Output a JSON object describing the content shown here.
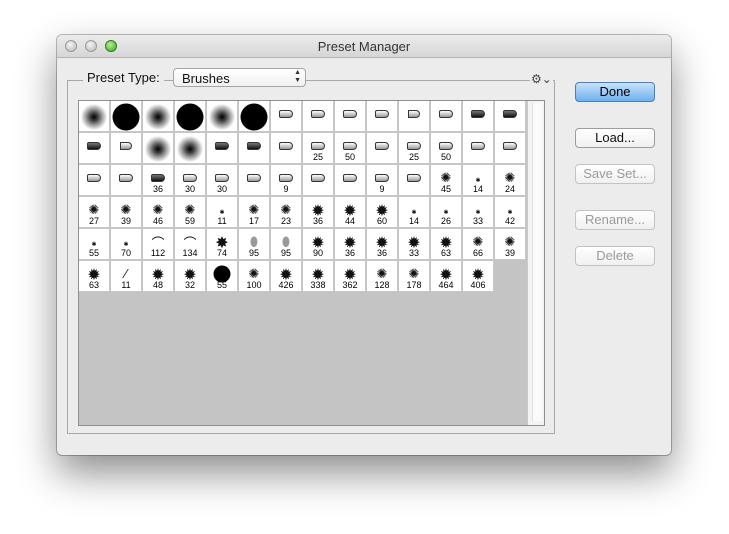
{
  "window": {
    "title": "Preset Manager"
  },
  "preset_type": {
    "label": "Preset Type:",
    "value": "Brushes",
    "options_icon": "gear-icon"
  },
  "buttons": {
    "done": "Done",
    "load": "Load...",
    "save_set": "Save Set...",
    "rename": "Rename...",
    "delete": "Delete"
  },
  "brushes": [
    {
      "kind": "soft",
      "num": ""
    },
    {
      "kind": "hard",
      "num": ""
    },
    {
      "kind": "soft",
      "num": ""
    },
    {
      "kind": "hard",
      "num": ""
    },
    {
      "kind": "soft",
      "num": ""
    },
    {
      "kind": "hard",
      "num": ""
    },
    {
      "kind": "pen",
      "num": ""
    },
    {
      "kind": "pen",
      "num": ""
    },
    {
      "kind": "pen",
      "num": ""
    },
    {
      "kind": "pen",
      "num": ""
    },
    {
      "kind": "fan",
      "num": ""
    },
    {
      "kind": "pen",
      "num": ""
    },
    {
      "kind": "penb",
      "num": ""
    },
    {
      "kind": "penb",
      "num": ""
    },
    {
      "kind": "penb",
      "num": ""
    },
    {
      "kind": "fan",
      "num": ""
    },
    {
      "kind": "soft",
      "num": ""
    },
    {
      "kind": "soft",
      "num": ""
    },
    {
      "kind": "penb",
      "num": ""
    },
    {
      "kind": "penb",
      "num": ""
    },
    {
      "kind": "pen",
      "num": ""
    },
    {
      "kind": "pen",
      "num": "25"
    },
    {
      "kind": "pen",
      "num": "50"
    },
    {
      "kind": "pen",
      "num": ""
    },
    {
      "kind": "pen",
      "num": "25"
    },
    {
      "kind": "pen",
      "num": "50"
    },
    {
      "kind": "pen",
      "num": ""
    },
    {
      "kind": "pen",
      "num": ""
    },
    {
      "kind": "pen",
      "num": ""
    },
    {
      "kind": "pen",
      "num": ""
    },
    {
      "kind": "penb",
      "num": "36"
    },
    {
      "kind": "pen",
      "num": "30"
    },
    {
      "kind": "pen",
      "num": "30"
    },
    {
      "kind": "pen",
      "num": ""
    },
    {
      "kind": "pen",
      "num": "9"
    },
    {
      "kind": "pen",
      "num": ""
    },
    {
      "kind": "pen",
      "num": ""
    },
    {
      "kind": "pen",
      "num": "9"
    },
    {
      "kind": "pen",
      "num": ""
    },
    {
      "kind": "speck",
      "num": "45"
    },
    {
      "kind": "dot",
      "num": "14"
    },
    {
      "kind": "speck",
      "num": "24"
    },
    {
      "kind": "speck",
      "num": "27"
    },
    {
      "kind": "speck",
      "num": "39"
    },
    {
      "kind": "speck",
      "num": "46"
    },
    {
      "kind": "speck",
      "num": "59"
    },
    {
      "kind": "dot",
      "num": "11"
    },
    {
      "kind": "speck",
      "num": "17"
    },
    {
      "kind": "speck",
      "num": "23"
    },
    {
      "kind": "specklg",
      "num": "36"
    },
    {
      "kind": "specklg",
      "num": "44"
    },
    {
      "kind": "specklg",
      "num": "60"
    },
    {
      "kind": "dot",
      "num": "14"
    },
    {
      "kind": "dot",
      "num": "26"
    },
    {
      "kind": "dot",
      "num": "33"
    },
    {
      "kind": "dot",
      "num": "42"
    },
    {
      "kind": "dot",
      "num": "55"
    },
    {
      "kind": "dot",
      "num": "70"
    },
    {
      "kind": "grass",
      "num": "112"
    },
    {
      "kind": "grass",
      "num": "134"
    },
    {
      "kind": "leaf",
      "num": "74"
    },
    {
      "kind": "leafo",
      "num": "95"
    },
    {
      "kind": "leafo",
      "num": "95"
    },
    {
      "kind": "specklg",
      "num": "90"
    },
    {
      "kind": "specklg",
      "num": "36"
    },
    {
      "kind": "specklg",
      "num": "36"
    },
    {
      "kind": "specklg",
      "num": "33"
    },
    {
      "kind": "specklg",
      "num": "63"
    },
    {
      "kind": "speck",
      "num": "66"
    },
    {
      "kind": "speck",
      "num": "39"
    },
    {
      "kind": "specklg",
      "num": "63"
    },
    {
      "kind": "stroke",
      "num": "11"
    },
    {
      "kind": "specklg",
      "num": "48"
    },
    {
      "kind": "specklg",
      "num": "32"
    },
    {
      "kind": "hard",
      "num": "55"
    },
    {
      "kind": "speck",
      "num": "100"
    },
    {
      "kind": "specklg",
      "num": "426"
    },
    {
      "kind": "specklg",
      "num": "338"
    },
    {
      "kind": "specklg",
      "num": "362"
    },
    {
      "kind": "speck",
      "num": "128"
    },
    {
      "kind": "speck",
      "num": "178"
    },
    {
      "kind": "specklg",
      "num": "464"
    },
    {
      "kind": "specklg",
      "num": "406"
    }
  ]
}
